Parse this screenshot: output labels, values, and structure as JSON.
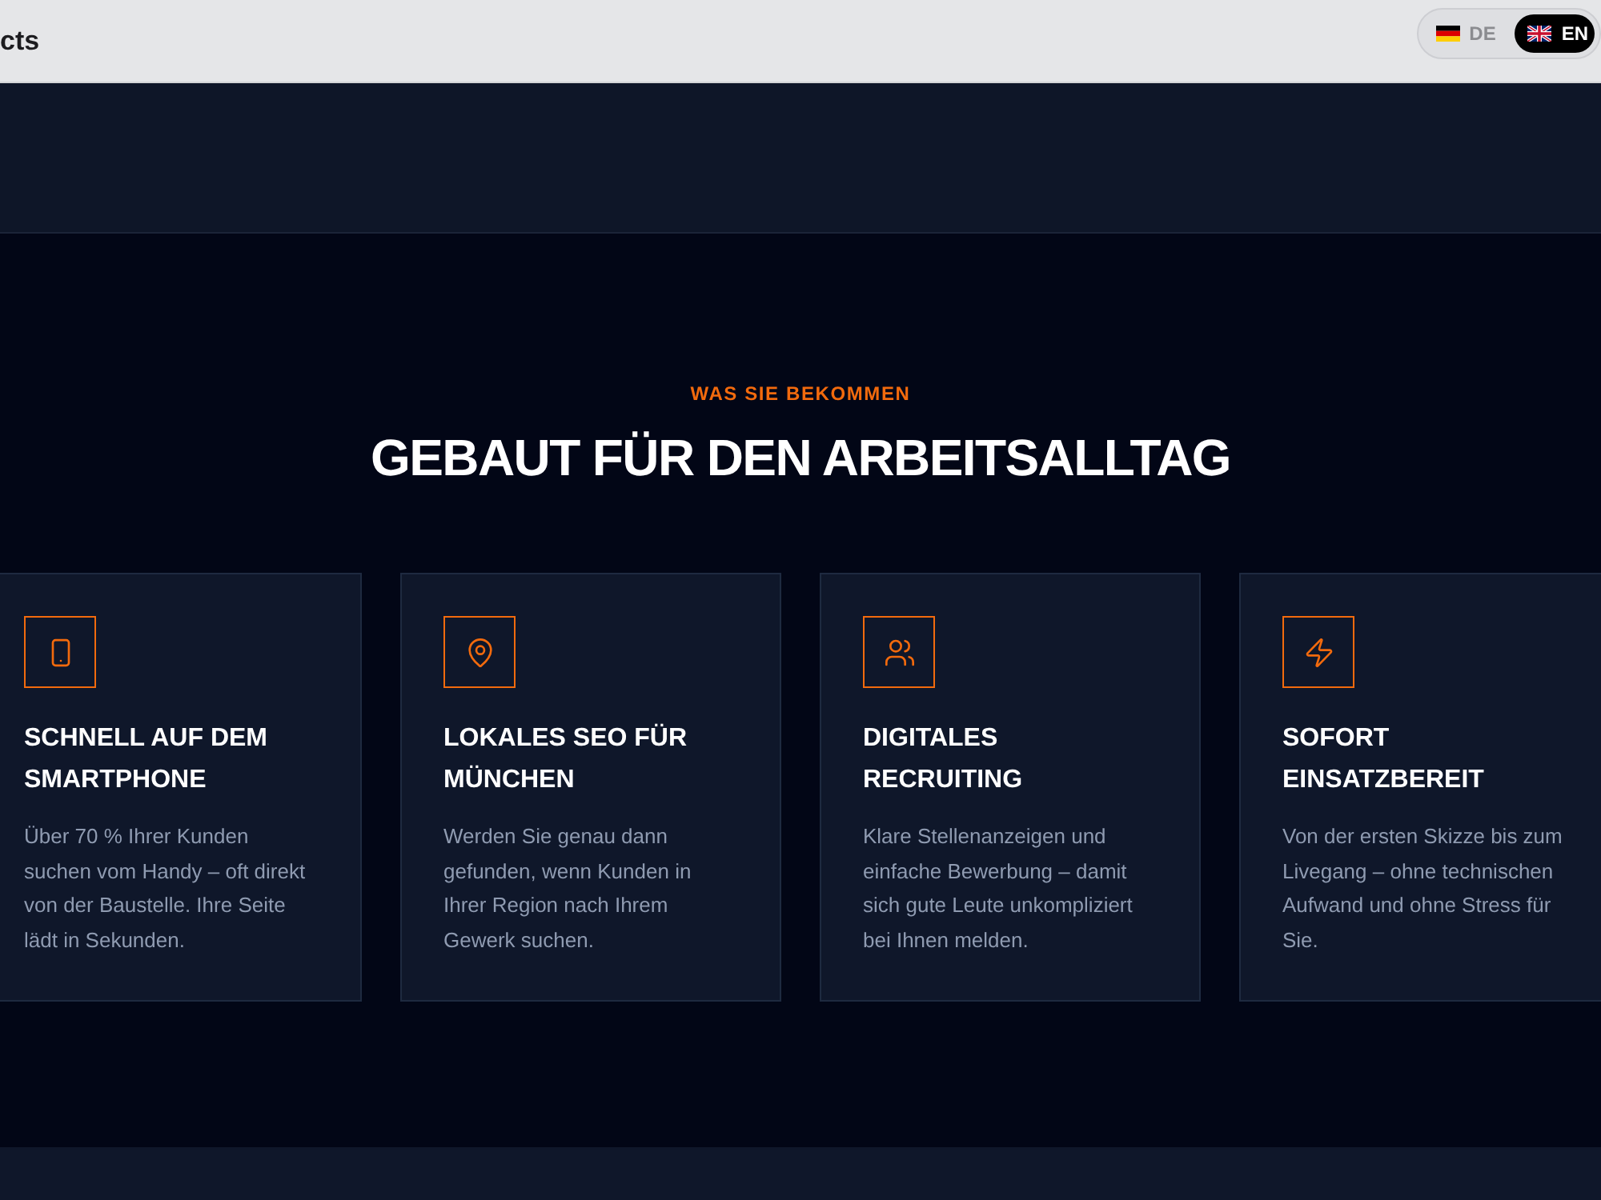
{
  "header": {
    "brand_text": "cts",
    "languages": [
      {
        "code": "DE",
        "selected": false
      },
      {
        "code": "EN",
        "selected": true
      }
    ]
  },
  "features": {
    "eyebrow": "WAS SIE BEKOMMEN",
    "heading": "GEBAUT FÜR DEN ARBEITSALLTAG",
    "cards": [
      {
        "title": "SCHNELL AUF DEM SMARTPHONE",
        "text": "Über 70 % Ihrer Kunden suchen vom Handy – oft direkt von der Baustelle. Ihre Seite lädt in Sekunden."
      },
      {
        "title": "LOKALES SEO FÜR MÜNCHEN",
        "text": "Werden Sie genau dann gefunden, wenn Kunden in Ihrer Region nach Ihrem Gewerk suchen."
      },
      {
        "title": "DIGITALES RECRUITING",
        "text": "Klare Stellenanzeigen und einfache Bewerbung – damit sich gute Leute unkompliziert bei Ihnen melden."
      },
      {
        "title": "SOFORT EINSATZBEREIT",
        "text": "Von der ersten Skizze bis zum Livegang – ohne technischen Aufwand und ohne Stress für Sie."
      }
    ]
  }
}
